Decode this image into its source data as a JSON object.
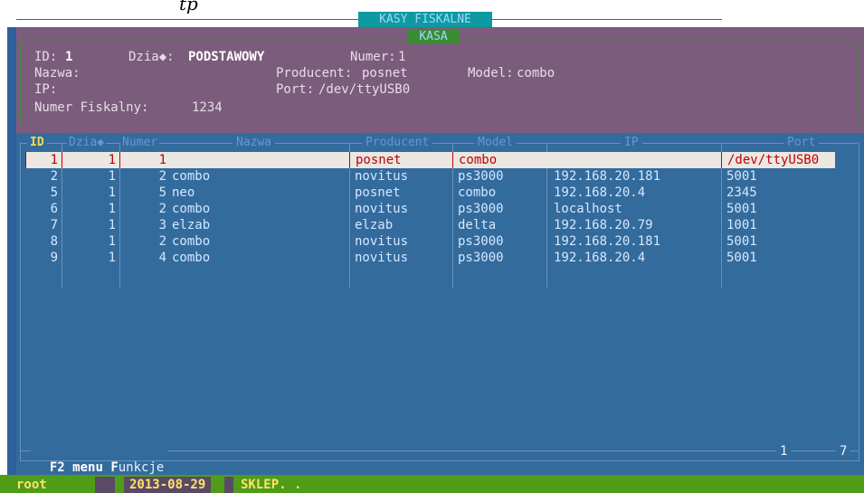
{
  "window": {
    "title": "KASY FISKALNE",
    "partial_header": "tp"
  },
  "kasa": {
    "panel_title": "KASA",
    "id_label": "ID:",
    "id_value": "1",
    "dzial_label": "Dzia◆:",
    "dzial_value": "PODSTAWOWY",
    "numer_label": "Numer:",
    "numer_value": "1",
    "nazwa_label": "Nazwa:",
    "producent_label": "Producent:",
    "producent_value": "posnet",
    "model_label": "Model:",
    "model_value": "combo",
    "ip_label": "IP:",
    "port_label": "Port:",
    "port_value": "/dev/ttyUSB0",
    "numer_fiskalny_label": "Numer Fiskalny:",
    "numer_fiskalny_value": "1234"
  },
  "table": {
    "headers": {
      "id": "ID",
      "dzial": "Dzia◆",
      "numer": "Numer",
      "nazwa": "Nazwa",
      "producent": "Producent",
      "model": "Model",
      "ip": "IP",
      "port": "Port"
    },
    "rows": [
      {
        "id": "1",
        "dzial": "1",
        "numer": "1",
        "nazwa": "",
        "producent": "posnet",
        "model": "combo",
        "ip": "",
        "port": "/dev/ttyUSB0"
      },
      {
        "id": "2",
        "dzial": "1",
        "numer": "2",
        "nazwa": "combo",
        "producent": "novitus",
        "model": "ps3000",
        "ip": "192.168.20.181",
        "port": "5001"
      },
      {
        "id": "5",
        "dzial": "1",
        "numer": "5",
        "nazwa": "neo",
        "producent": "posnet",
        "model": "combo",
        "ip": "192.168.20.4",
        "port": "2345"
      },
      {
        "id": "6",
        "dzial": "1",
        "numer": "2",
        "nazwa": "combo",
        "producent": "novitus",
        "model": "ps3000",
        "ip": "localhost",
        "port": "5001"
      },
      {
        "id": "7",
        "dzial": "1",
        "numer": "3",
        "nazwa": "elzab",
        "producent": "elzab",
        "model": "delta",
        "ip": "192.168.20.79",
        "port": "1001"
      },
      {
        "id": "8",
        "dzial": "1",
        "numer": "2",
        "nazwa": "combo",
        "producent": "novitus",
        "model": "ps3000",
        "ip": "192.168.20.181",
        "port": "5001"
      },
      {
        "id": "9",
        "dzial": "1",
        "numer": "4",
        "nazwa": "combo",
        "producent": "novitus",
        "model": "ps3000",
        "ip": "192.168.20.4",
        "port": "5001"
      }
    ]
  },
  "footer": {
    "f2_key": "F2",
    "menu": "menu",
    "f_key": "F",
    "funkcje": "unkcje",
    "pos_current": "1",
    "pos_total": "7"
  },
  "status": {
    "user": "root",
    "date": "2013-08-29",
    "shop": "SKLEP. ."
  },
  "colors": {
    "background": "#346b9d",
    "kasa_panel": "#7b5c7c",
    "selected_row": "#ebe7e2",
    "selected_text": "#c00000",
    "statusbar": "#4f9c18"
  }
}
